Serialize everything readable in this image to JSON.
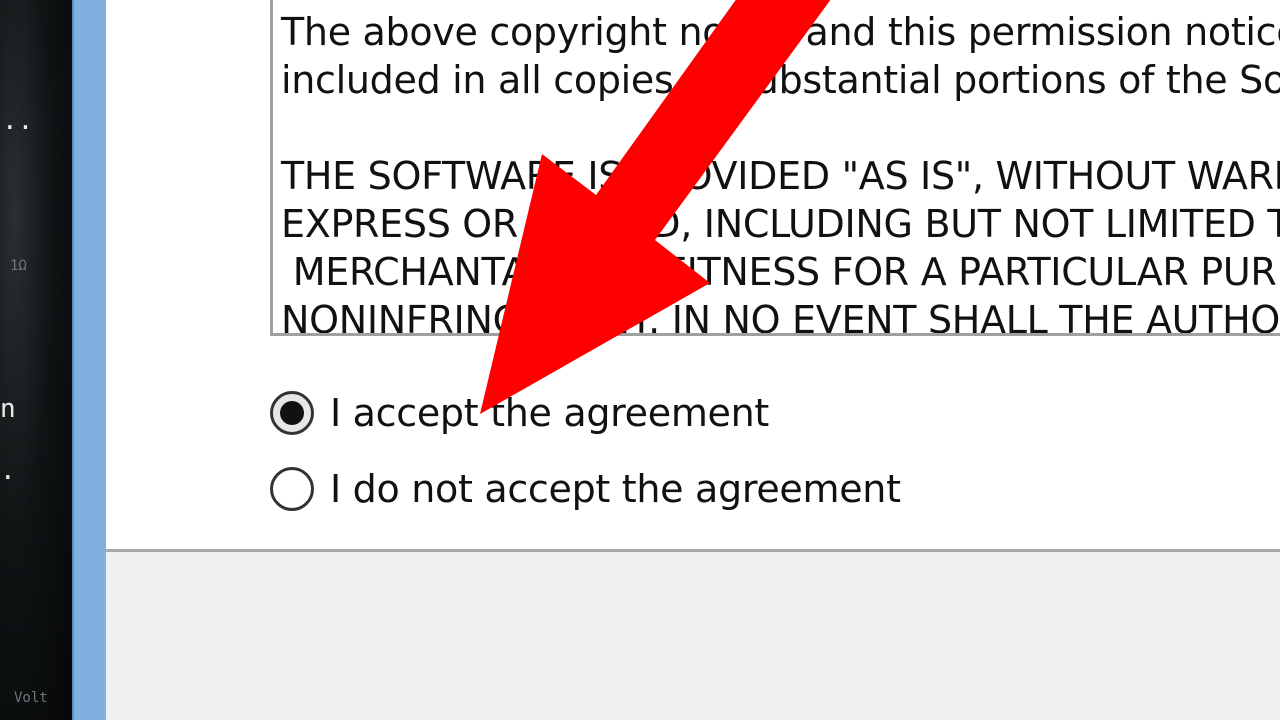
{
  "desktop": {
    "fragments": [
      "..",
      "n",
      "."
    ],
    "faint_fragments": [
      "1Ω",
      "Volt"
    ]
  },
  "license": {
    "lines": [
      "The above copyright notice and this permission notice shall be",
      "included in all copies or substantial portions of the Software.",
      "",
      "THE SOFTWARE IS PROVIDED \"AS IS\", WITHOUT WARRANTY OF ANY KIND,",
      "EXPRESS OR IMPLIED, INCLUDING BUT NOT LIMITED TO THE WARRANTIES OF",
      " MERCHANTABILITY, FITNESS FOR A PARTICULAR PURPOSE AND",
      "NONINFRINGEMENT. IN NO EVENT SHALL THE AUTHORS OR COPYRIGHT"
    ]
  },
  "agreement": {
    "accept_label": "I accept the agreement",
    "decline_label": "I do not accept the agreement",
    "selected": "accept"
  },
  "annotation": {
    "type": "arrow",
    "color": "#ff0000",
    "target": "accept-agreement-radio"
  }
}
